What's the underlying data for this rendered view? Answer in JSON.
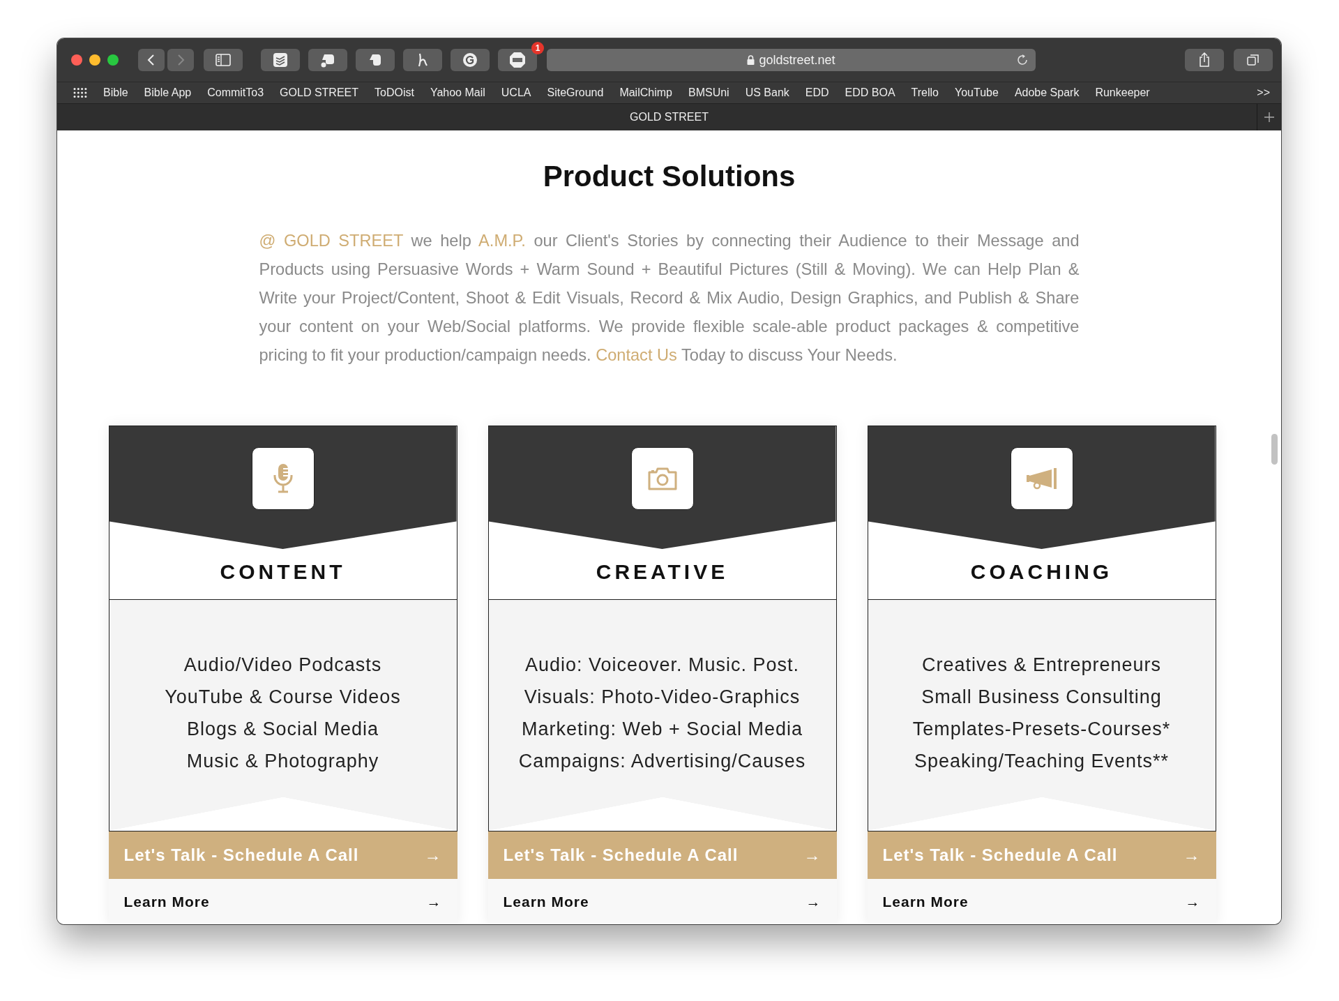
{
  "browser": {
    "url": "goldstreet.net",
    "extensions": [
      {
        "kind": "todoist"
      },
      {
        "kind": "evernote-clip"
      },
      {
        "kind": "evernote"
      },
      {
        "kind": "honey"
      },
      {
        "kind": "grammarly"
      },
      {
        "kind": "abp",
        "badge": "1"
      }
    ],
    "bookmarks": [
      "Bible",
      "Bible App",
      "CommitTo3",
      "GOLD STREET",
      "ToDOist",
      "Yahoo Mail",
      "UCLA",
      "SiteGround",
      "MailChimp",
      "BMSUni",
      "US Bank",
      "EDD",
      "EDD BOA",
      "Trello",
      "YouTube",
      "Adobe Spark",
      "Runkeeper"
    ],
    "more": ">>",
    "tab_title": "GOLD STREET"
  },
  "page": {
    "heading": "Product Solutions",
    "intro": [
      {
        "kind": "gold",
        "text": "@ GOLD STREET"
      },
      {
        "kind": "plain",
        "text": " we help "
      },
      {
        "kind": "gold",
        "text": "A.M.P."
      },
      {
        "kind": "plain",
        "text": " our Client's Stories by connecting their Audience to their Message and Products using Persuasive Words + Warm Sound + Beautiful Pictures (Still & Moving). We can Help Plan & Write your Project/Content, Shoot & Edit Visuals, Record & Mix Audio, Design Graphics, and Publish & Share your content on your Web/Social platforms. We provide flexible scale-able product packages & competitive pricing to fit your production/campaign needs. "
      },
      {
        "kind": "link",
        "text": "Contact Us"
      },
      {
        "kind": "plain",
        "text": " Today to discuss Your Needs."
      }
    ],
    "cards": [
      {
        "title": "CONTENT",
        "lines": [
          "Audio/Video Podcasts",
          "YouTube & Course Videos",
          "Blogs & Social Media",
          "Music & Photography"
        ],
        "cta": "Let's Talk - Schedule A Call",
        "cta_arrow": "→",
        "more": "Learn More",
        "more_arrow": "→"
      },
      {
        "title": "CREATIVE",
        "lines": [
          "Audio: Voiceover. Music. Post.",
          "Visuals: Photo-Video-Graphics",
          "Marketing: Web + Social Media",
          "Campaigns: Advertising/Causes"
        ],
        "cta": "Let's Talk - Schedule A Call",
        "cta_arrow": "→",
        "more": "Learn More",
        "more_arrow": "→"
      },
      {
        "title": "COACHING",
        "lines": [
          "Creatives & Entrepreneurs",
          "Small Business Consulting",
          "Templates-Presets-Courses*",
          "Speaking/Teaching Events**"
        ],
        "cta": "Let's Talk - Schedule A Call",
        "cta_arrow": "→",
        "more": "Learn More",
        "more_arrow": "→"
      }
    ]
  }
}
